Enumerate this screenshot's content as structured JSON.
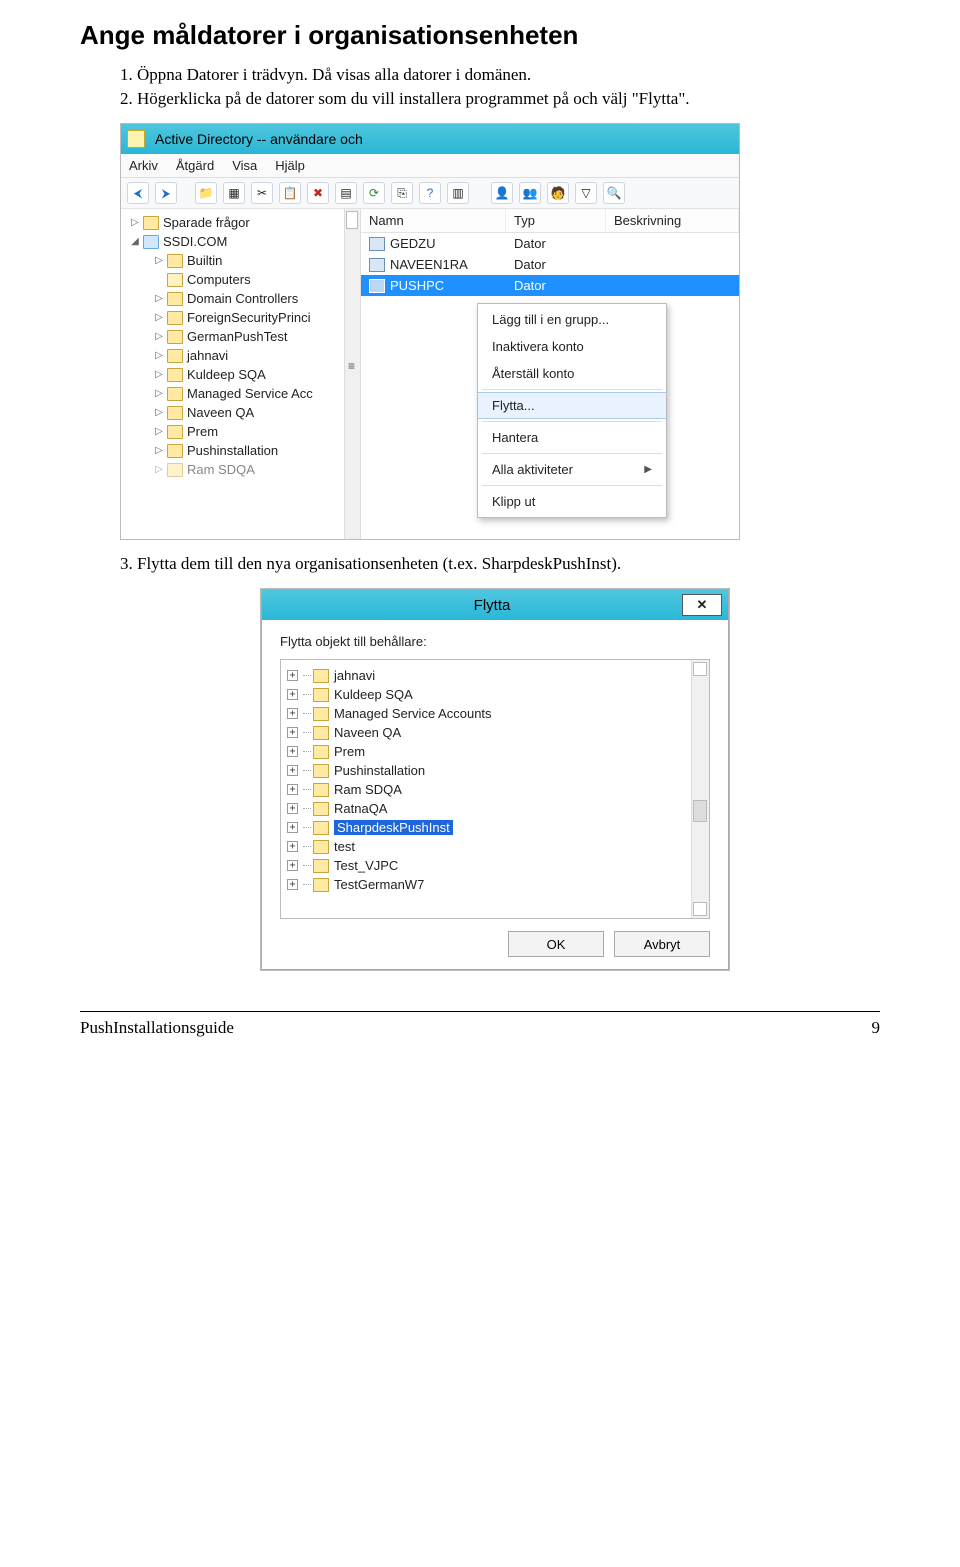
{
  "heading": "Ange måldatorer i organisationsenheten",
  "steps": {
    "s1": "1. Öppna Datorer i trädvyn. Då visas alla datorer i domänen.",
    "s2": "2. Högerklicka på de datorer som du vill installera programmet på och välj \"Flytta\".",
    "s3": "3. Flytta dem till den nya organisationsenheten (t.ex. SharpdeskPushInst)."
  },
  "ss1": {
    "title": "Active Directory -- användare och",
    "menus": [
      "Arkiv",
      "Åtgärd",
      "Visa",
      "Hjälp"
    ],
    "tree": {
      "root1": "Sparade frågor",
      "domain": "SSDI.COM",
      "children": [
        "Builtin",
        "Computers",
        "Domain Controllers",
        "ForeignSecurityPrinci",
        "GermanPushTest",
        "jahnavi",
        "Kuldeep SQA",
        "Managed Service Acc",
        "Naveen QA",
        "Prem",
        "Pushinstallation",
        "Ram SDQA"
      ]
    },
    "cols": {
      "name": "Namn",
      "type": "Typ",
      "desc": "Beskrivning"
    },
    "rows": [
      {
        "name": "GEDZU",
        "type": "Dator"
      },
      {
        "name": "NAVEEN1RA",
        "type": "Dator"
      },
      {
        "name": "PUSHPC",
        "type": "Dator",
        "sel": true
      }
    ],
    "ctx": {
      "add": "Lägg till i en grupp...",
      "disable": "Inaktivera konto",
      "reset": "Återställ konto",
      "move": "Flytta...",
      "manage": "Hantera",
      "all": "Alla aktiviteter",
      "cut": "Klipp ut"
    }
  },
  "ss2": {
    "title": "Flytta",
    "label": "Flytta objekt till behållare:",
    "items": [
      "jahnavi",
      "Kuldeep SQA",
      "Managed Service Accounts",
      "Naveen QA",
      "Prem",
      "Pushinstallation",
      "Ram SDQA",
      "RatnaQA",
      "SharpdeskPushInst",
      "test",
      "Test_VJPC",
      "TestGermanW7"
    ],
    "selected": "SharpdeskPushInst",
    "ok": "OK",
    "cancel": "Avbryt"
  },
  "footer": {
    "doc": "PushInstallationsguide",
    "page": "9"
  }
}
